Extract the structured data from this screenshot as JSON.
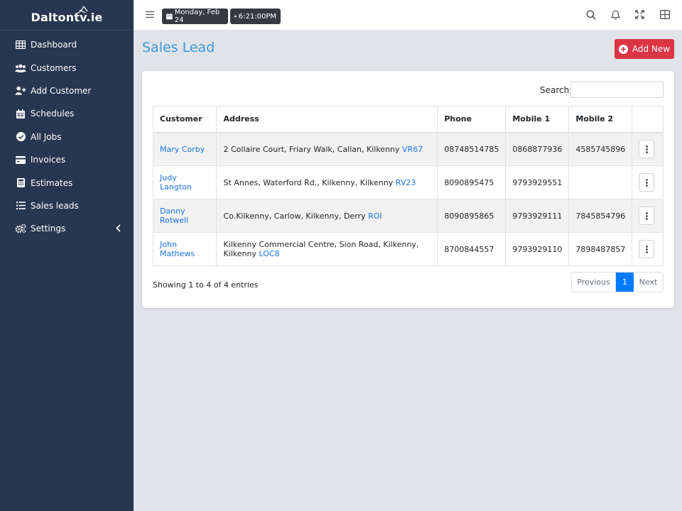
{
  "brand": {
    "name": "Daltontv.ie"
  },
  "datetime": {
    "date": "Monday, Feb 24",
    "time": "6:21:00PM"
  },
  "sidebar": {
    "items": [
      {
        "label": "Dashboard",
        "icon": "dashboard-icon"
      },
      {
        "label": "Customers",
        "icon": "users-icon"
      },
      {
        "label": "Add Customer",
        "icon": "user-plus-icon"
      },
      {
        "label": "Schedules",
        "icon": "calendar-icon"
      },
      {
        "label": "All Jobs",
        "icon": "check-circle-icon"
      },
      {
        "label": "Invoices",
        "icon": "credit-card-icon"
      },
      {
        "label": "Estimates",
        "icon": "calculator-icon"
      },
      {
        "label": "Sales leads",
        "icon": "list-icon"
      },
      {
        "label": "Settings",
        "icon": "cogs-icon"
      }
    ]
  },
  "page": {
    "title": "Sales Lead",
    "add_label": "Add New"
  },
  "search": {
    "label": "Search:",
    "value": ""
  },
  "table": {
    "headers": [
      "Customer",
      "Address",
      "Phone",
      "Mobile 1",
      "Mobile 2",
      ""
    ],
    "rows": [
      {
        "customer": "Mary Corby",
        "address": "2 Collaire Court, Friary Walk, Callan, Kilkenny",
        "code": "VR67",
        "phone": "08748514785",
        "mobile1": "0868877936",
        "mobile2": "4585745896"
      },
      {
        "customer": "Judy Langton",
        "address": "St Annes, Waterford Rd., Kilkenny, Kilkenny",
        "code": "RV23",
        "phone": "8090895475",
        "mobile1": "9793929551",
        "mobile2": ""
      },
      {
        "customer": "Danny Rotwell",
        "address": "Co.Kilkenny, Carlow, Kilkenny, Derry",
        "code": "ROI",
        "phone": "8090895865",
        "mobile1": "9793929111",
        "mobile2": "7845854796"
      },
      {
        "customer": "John Mathews",
        "address": "Kilkenny Commercial Centre, Sion Road, Kilkenny, Kilkenny",
        "code": "LOC8",
        "phone": "8700844557",
        "mobile1": "9793929110",
        "mobile2": "7898487857"
      }
    ]
  },
  "footer": {
    "entries": "Showing 1 to 4 of 4 entries",
    "prev": "Previous",
    "page": "1",
    "next": "Next"
  },
  "colors": {
    "sidebar": "#283750",
    "accent": "#3a96d8",
    "danger": "#dc3545",
    "primary": "#007bff"
  }
}
